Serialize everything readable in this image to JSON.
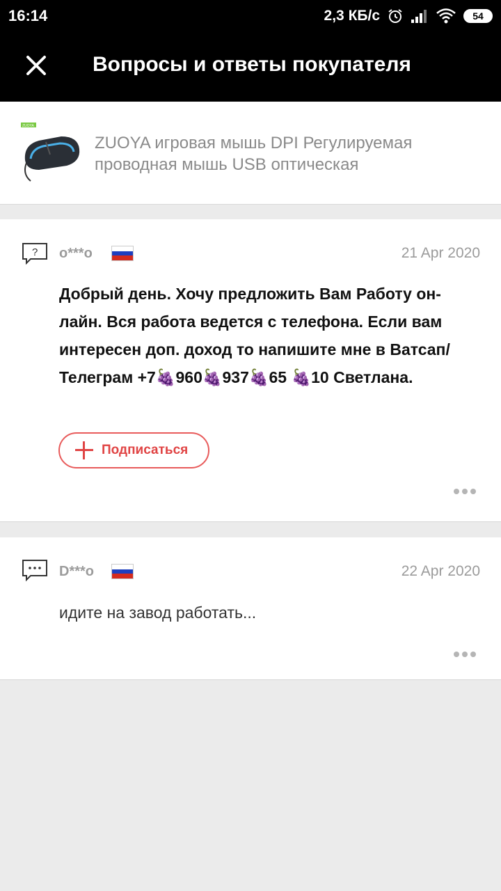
{
  "status_bar": {
    "time": "16:14",
    "speed": "2,3 КБ/с",
    "battery": "54"
  },
  "header": {
    "title": "Вопросы и ответы покупателя",
    "close_icon": "close-icon"
  },
  "product": {
    "title": "ZUOYA игровая мышь DPI Регулируемая проводная мышь USB оптическая",
    "thumb_brand": "ZUOYA"
  },
  "questions": [
    {
      "user": "o***o",
      "date": "21 Apr 2020",
      "text_parts": [
        "Добрый день. Хочу предложить Вам Работу он-лайн. Вся работа ведется с телефона. Если вам интересен доп. доход то напишите мне в Ватсап/Телеграм +7",
        "🍇",
        "960",
        "🍇",
        "937",
        "🍇",
        "65 ",
        "🍇",
        "10 Светлана."
      ],
      "subscribe_label": "Подписаться",
      "icon": "question-icon"
    },
    {
      "user": "D***o",
      "date": "22 Apr 2020",
      "text": "идите на завод работать...",
      "icon": "comment-icon"
    }
  ],
  "colors": {
    "accent": "#e04444",
    "muted": "#9b9b9b",
    "background": "#ebebeb"
  }
}
